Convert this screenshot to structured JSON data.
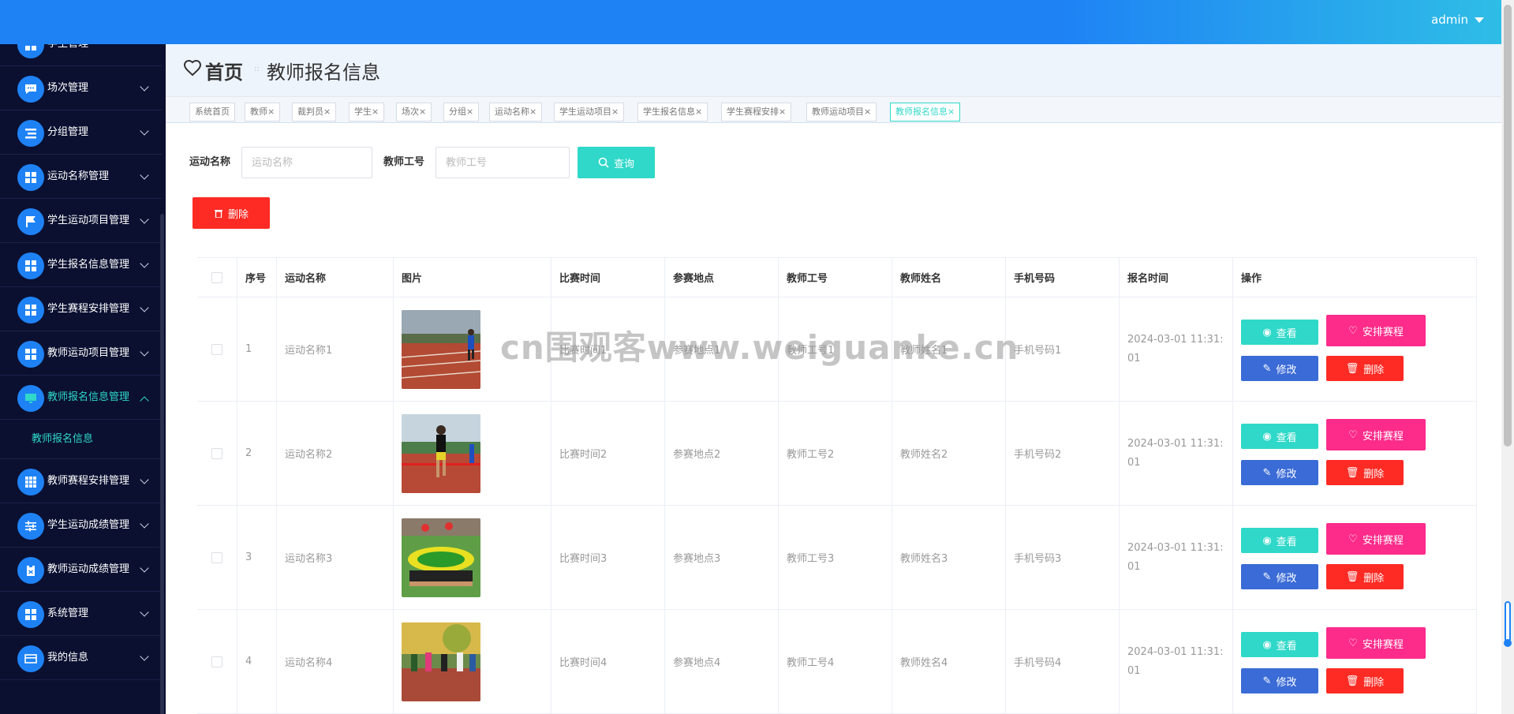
{
  "header": {
    "user": "admin"
  },
  "sidebar": {
    "items": [
      {
        "label": "学生管理",
        "icon": "grid-icon"
      },
      {
        "label": "场次管理",
        "icon": "chat-icon"
      },
      {
        "label": "分组管理",
        "icon": "list-icon"
      },
      {
        "label": "运动名称管理",
        "icon": "grid-icon"
      },
      {
        "label": "学生运动项目管理",
        "icon": "flag-icon"
      },
      {
        "label": "学生报名信息管理",
        "icon": "grid-icon"
      },
      {
        "label": "学生赛程安排管理",
        "icon": "grid-icon"
      },
      {
        "label": "教师运动项目管理",
        "icon": "grid-icon"
      },
      {
        "label": "教师报名信息管理",
        "icon": "monitor-icon"
      },
      {
        "label": "教师赛程安排管理",
        "icon": "table-icon"
      },
      {
        "label": "学生运动成绩管理",
        "icon": "sliders-icon"
      },
      {
        "label": "教师运动成绩管理",
        "icon": "clipboard-icon"
      },
      {
        "label": "系统管理",
        "icon": "grid-icon"
      },
      {
        "label": "我的信息",
        "icon": "card-icon"
      }
    ],
    "submenu": "教师报名信息"
  },
  "breadcrumb": {
    "home": "首页",
    "separator": "::",
    "current": "教师报名信息"
  },
  "tabs": [
    "系统首页",
    "教师",
    "裁判员",
    "学生",
    "场次",
    "分组",
    "运动名称",
    "学生运动项目",
    "学生报名信息",
    "学生赛程安排",
    "教师运动项目",
    "教师报名信息"
  ],
  "search": {
    "label1": "运动名称",
    "placeholder1": "运动名称",
    "label2": "教师工号",
    "placeholder2": "教师工号",
    "query_btn": "查询"
  },
  "delete_btn": "删除",
  "table": {
    "headers": [
      "序号",
      "运动名称",
      "图片",
      "比赛时间",
      "参赛地点",
      "教师工号",
      "教师姓名",
      "手机号码",
      "报名时间",
      "操作"
    ],
    "rows": [
      {
        "no": "1",
        "name": "运动名称1",
        "time": "比赛时间1",
        "place": "参赛地点1",
        "tid": "教师工号1",
        "tname": "教师姓名1",
        "phone": "手机号码1",
        "reg1": "2024-03-01 11:31:",
        "reg2": "01"
      },
      {
        "no": "2",
        "name": "运动名称2",
        "time": "比赛时间2",
        "place": "参赛地点2",
        "tid": "教师工号2",
        "tname": "教师姓名2",
        "phone": "手机号码2",
        "reg1": "2024-03-01 11:31:",
        "reg2": "01"
      },
      {
        "no": "3",
        "name": "运动名称3",
        "time": "比赛时间3",
        "place": "参赛地点3",
        "tid": "教师工号3",
        "tname": "教师姓名3",
        "phone": "手机号码3",
        "reg1": "2024-03-01 11:31:",
        "reg2": "01"
      },
      {
        "no": "4",
        "name": "运动名称4",
        "time": "比赛时间4",
        "place": "参赛地点4",
        "tid": "教师工号4",
        "tname": "教师姓名4",
        "phone": "手机号码4",
        "reg1": "2024-03-01 11:31:",
        "reg2": "01"
      }
    ],
    "ops": {
      "view": "查看",
      "arrange": "安排赛程",
      "edit": "修改",
      "delete": "删除"
    }
  },
  "watermark": "cn围观客www.weiguanke.cn",
  "colors": {
    "primary": "#1e82f5",
    "teal": "#2fd8c8",
    "red": "#fd2b24",
    "pink": "#fd2b8a",
    "blue": "#3a6bd6",
    "sidebar": "#0b1031"
  }
}
